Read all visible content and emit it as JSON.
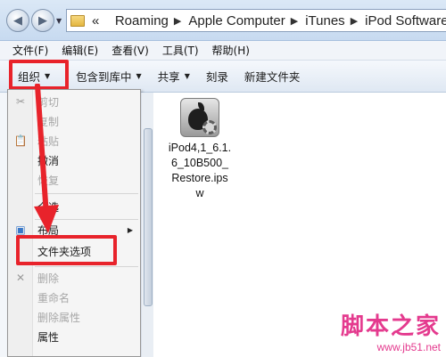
{
  "address": {
    "overflow": "«",
    "crumbs": [
      "Roaming",
      "Apple Computer",
      "iTunes",
      "iPod Software Updates"
    ]
  },
  "menubar": [
    "文件(F)",
    "编辑(E)",
    "查看(V)",
    "工具(T)",
    "帮助(H)"
  ],
  "commands": {
    "organize": "组织",
    "include_library": "包含到库中",
    "share": "共享",
    "burn": "刻录",
    "new_folder": "新建文件夹"
  },
  "dropdown": {
    "cut": "剪切",
    "copy": "复制",
    "paste": "粘贴",
    "undo": "撤消",
    "redo": "恢复",
    "select_all": "全选",
    "layout": "布局",
    "folder_options": "文件夹选项",
    "delete": "删除",
    "rename": "重命名",
    "remove_props": "删除属性",
    "properties": "属性"
  },
  "file": {
    "name": "iPod4,1_6.1.6_10B500_Restore.ipsw"
  },
  "watermark": {
    "main": "脚本之家",
    "sub": "www.jb51.net"
  },
  "colors": {
    "highlight": "#e8232b",
    "watermark": "#e43a8e"
  }
}
